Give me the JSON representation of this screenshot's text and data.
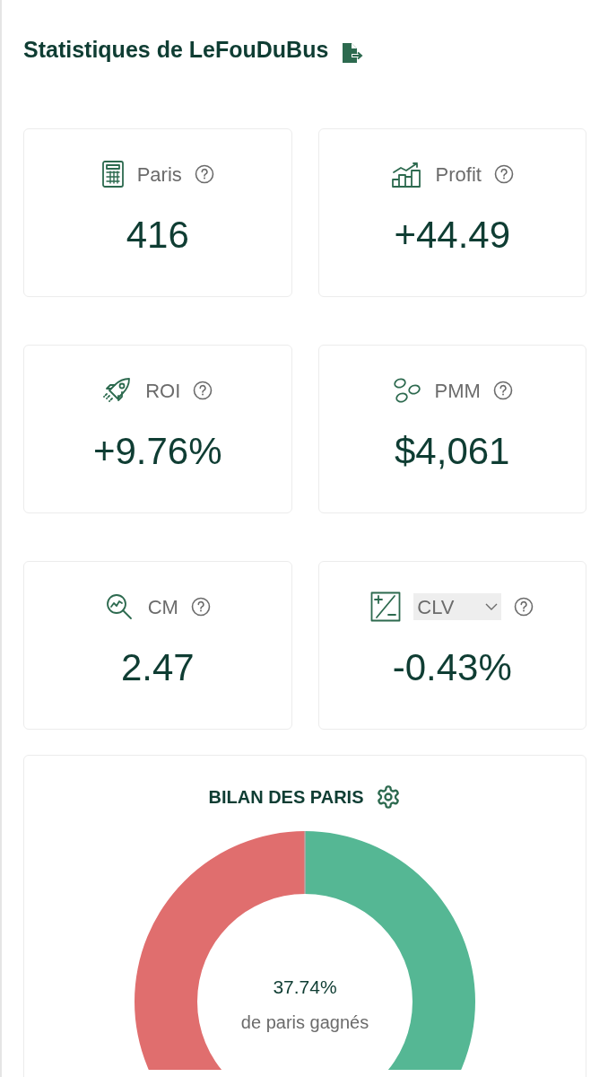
{
  "title": "Statistiques de LeFouDuBus",
  "stats": [
    {
      "kind": "label",
      "label": "Paris",
      "value": "416"
    },
    {
      "kind": "label",
      "label": "Profit",
      "value": "+44.49"
    },
    {
      "kind": "label",
      "label": "ROI",
      "value": "+9.76%"
    },
    {
      "kind": "label",
      "label": "PMM",
      "value": "$4,061"
    },
    {
      "kind": "label",
      "label": "CM",
      "value": "2.47"
    },
    {
      "kind": "select",
      "label": "CLV",
      "value": "-0.43%"
    }
  ],
  "summary": {
    "title": "BILAN DES PARIS",
    "percent": "37.74%",
    "caption": "de paris gagnés"
  }
}
